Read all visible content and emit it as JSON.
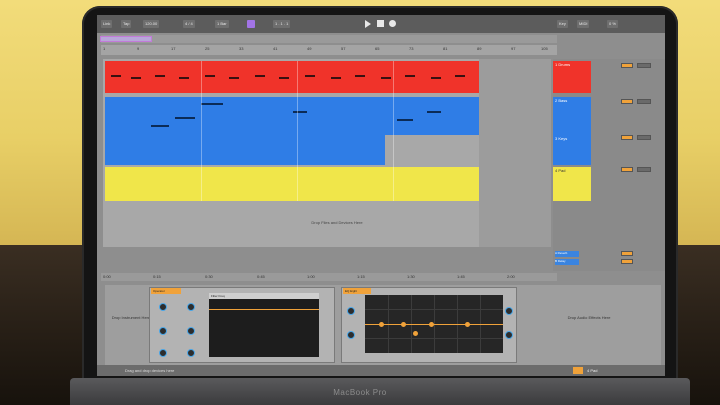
{
  "scene": {
    "brand_text": "MacBook Pro"
  },
  "daw": {
    "topbar": {
      "link": "Link",
      "tap": "Tap",
      "tempo": "120.00",
      "meter": "4 / 4",
      "bar": "1 Bar",
      "position": "1 . 1 . 1",
      "key": "Key",
      "midi": "MIDI",
      "cpu": "0 %"
    },
    "ruler": [
      "1",
      "9",
      "17",
      "25",
      "33",
      "41",
      "49",
      "57",
      "65",
      "73",
      "81",
      "89",
      "97",
      "105"
    ],
    "lower_ruler": [
      "0:00",
      "0:15",
      "0:30",
      "0:45",
      "1:00",
      "1:15",
      "1:30",
      "1:45",
      "2:00"
    ],
    "drop_files_hint": "Drop Files and Devices Here",
    "tracks": [
      {
        "name": "1 Drums",
        "color": "#f0332a"
      },
      {
        "name": "2 Bass",
        "color": "#2f7de6"
      },
      {
        "name": "3 Keys",
        "color": "#2f7de6"
      },
      {
        "name": "4 Pad",
        "color": "#f0e64a"
      }
    ],
    "returns": [
      {
        "name": "A Reverb"
      },
      {
        "name": "B Delay"
      }
    ],
    "devices": {
      "drop_instrument": "Drop Instrument Here",
      "device1_title": "Operator",
      "device1_bar": "Filter Freq",
      "device2_title": "EQ Eight",
      "drop_fx": "Drop Audio Effects Here"
    },
    "status": {
      "text": "Drag and drop devices here",
      "track_label": "4 Pad"
    }
  }
}
